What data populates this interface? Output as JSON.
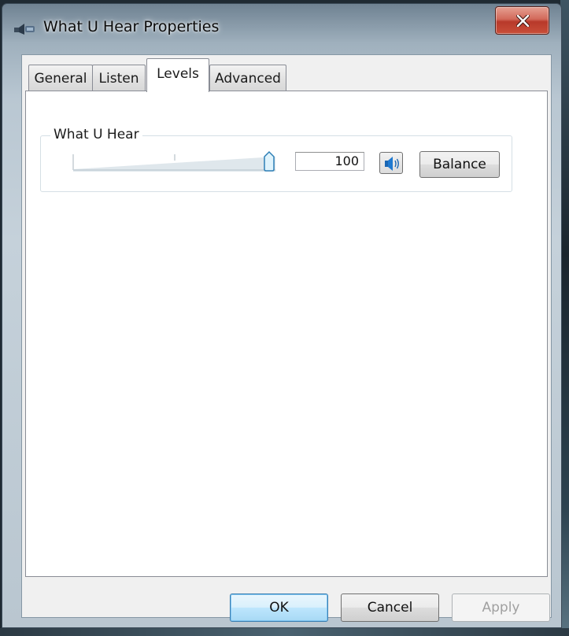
{
  "window": {
    "title": "What U Hear Properties",
    "icon": "speaker-device-icon",
    "close_icon": "close-icon"
  },
  "tabs": [
    {
      "label": "General",
      "active": false
    },
    {
      "label": "Listen",
      "active": false
    },
    {
      "label": "Levels",
      "active": true
    },
    {
      "label": "Advanced",
      "active": false
    }
  ],
  "levels": {
    "group_label": "What U Hear",
    "slider_level_percent": 100,
    "value": "100",
    "mute_icon": "speaker-volume-icon",
    "balance_label": "Balance"
  },
  "buttons": {
    "ok": "OK",
    "cancel": "Cancel",
    "apply": "Apply"
  },
  "colors": {
    "close_red": "#c94f3a",
    "default_button_blue": "#3c7fb1"
  }
}
